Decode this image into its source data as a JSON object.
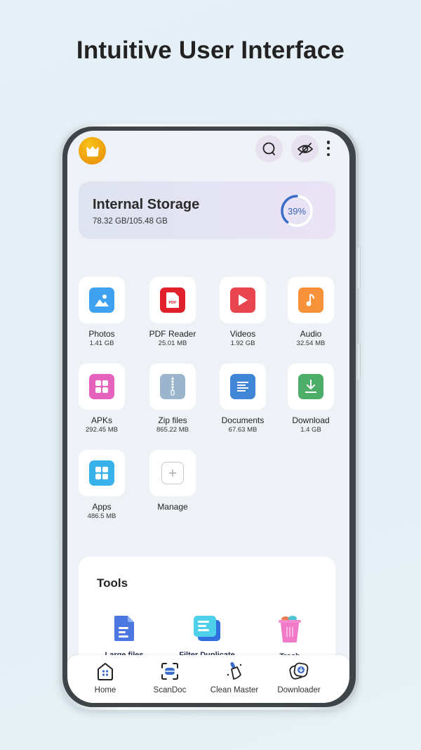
{
  "headline": "Intuitive User Interface",
  "top_bar": {
    "premium_icon": "crown-icon",
    "search_icon": "search-icon",
    "hide_icon": "eye-off-icon",
    "more_icon": "more-vertical-icon"
  },
  "storage": {
    "title": "Internal Storage",
    "usage": "78.32 GB/105.48 GB",
    "percent_label": "39%",
    "percent_value": 39,
    "accent_color": "#3a6cc8"
  },
  "categories": [
    {
      "label": "Photos",
      "size": "1.41 GB",
      "icon": "image-icon",
      "color": "#3fa2f0"
    },
    {
      "label": "PDF Reader",
      "size": "25.01 MB",
      "icon": "pdf-icon",
      "color": "#e0202a"
    },
    {
      "label": "Videos",
      "size": "1.92 GB",
      "icon": "play-icon",
      "color": "#e8454e"
    },
    {
      "label": "Audio",
      "size": "32.54 MB",
      "icon": "music-note-icon",
      "color": "#f7923a"
    },
    {
      "label": "APKs",
      "size": "292.45 MB",
      "icon": "apk-grid-icon",
      "color": "#e563bd"
    },
    {
      "label": "Zip files",
      "size": "865.22 MB",
      "icon": "zip-icon",
      "color": "#9ab5cc"
    },
    {
      "label": "Documents",
      "size": "67.63 MB",
      "icon": "document-icon",
      "color": "#3f86d6"
    },
    {
      "label": "Download",
      "size": "1.4 GB",
      "icon": "download-icon",
      "color": "#4cae68"
    },
    {
      "label": "Apps",
      "size": "486.5 MB",
      "icon": "apps-grid-icon",
      "color": "#37b2ea"
    },
    {
      "label": "Manage",
      "size": "",
      "icon": "plus-icon",
      "color": "#cccccc"
    }
  ],
  "tools": {
    "title": "Tools",
    "items": [
      {
        "label": "Large files",
        "icon": "large-file-icon",
        "bg": "#e8eefc"
      },
      {
        "label": "Filter Duplicate",
        "icon": "duplicate-icon",
        "bg": "#e6f9fc"
      },
      {
        "label": "Trash",
        "icon": "trash-icon",
        "bg": "#fdeef8"
      }
    ]
  },
  "bottom_nav": [
    {
      "label": "Home",
      "icon": "home-icon"
    },
    {
      "label": "ScanDoc",
      "icon": "scan-icon"
    },
    {
      "label": "Clean Master",
      "icon": "broom-icon"
    },
    {
      "label": "Downloader",
      "icon": "downloader-icon"
    }
  ]
}
